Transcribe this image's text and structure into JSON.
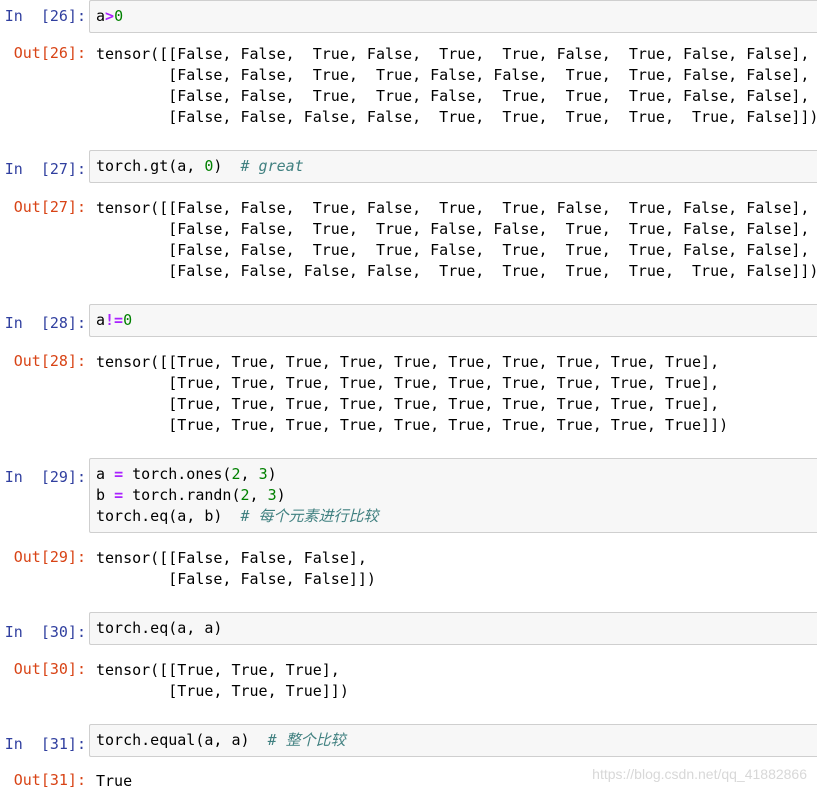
{
  "cells": [
    {
      "in_prompt": "In  [26]:",
      "code": [
        [
          {
            "t": "a"
          },
          {
            "t": ">",
            "c": "op"
          },
          {
            "t": "0",
            "c": "num"
          }
        ]
      ],
      "out_prompt": "Out[26]:",
      "output": [
        "tensor([[False, False,  True, False,  True,  True, False,  True, False, False],",
        "        [False, False,  True,  True, False, False,  True,  True, False, False],",
        "        [False, False,  True,  True, False,  True,  True,  True, False, False],",
        "        [False, False, False, False,  True,  True,  True,  True,  True, False]])"
      ]
    },
    {
      "in_prompt": "In  [27]:",
      "code": [
        [
          {
            "t": "torch.gt(a, "
          },
          {
            "t": "0",
            "c": "num"
          },
          {
            "t": ")  "
          },
          {
            "t": "# great",
            "c": "cmt"
          }
        ]
      ],
      "out_prompt": "Out[27]:",
      "output": [
        "tensor([[False, False,  True, False,  True,  True, False,  True, False, False],",
        "        [False, False,  True,  True, False, False,  True,  True, False, False],",
        "        [False, False,  True,  True, False,  True,  True,  True, False, False],",
        "        [False, False, False, False,  True,  True,  True,  True,  True, False]])"
      ]
    },
    {
      "in_prompt": "In  [28]:",
      "code": [
        [
          {
            "t": "a"
          },
          {
            "t": "!=",
            "c": "op"
          },
          {
            "t": "0",
            "c": "num"
          }
        ]
      ],
      "out_prompt": "Out[28]:",
      "output": [
        "tensor([[True, True, True, True, True, True, True, True, True, True],",
        "        [True, True, True, True, True, True, True, True, True, True],",
        "        [True, True, True, True, True, True, True, True, True, True],",
        "        [True, True, True, True, True, True, True, True, True, True]])"
      ]
    },
    {
      "in_prompt": "In  [29]:",
      "code": [
        [
          {
            "t": "a "
          },
          {
            "t": "=",
            "c": "op"
          },
          {
            "t": " torch.ones("
          },
          {
            "t": "2",
            "c": "num"
          },
          {
            "t": ", "
          },
          {
            "t": "3",
            "c": "num"
          },
          {
            "t": ")"
          }
        ],
        [
          {
            "t": "b "
          },
          {
            "t": "=",
            "c": "op"
          },
          {
            "t": " torch.randn("
          },
          {
            "t": "2",
            "c": "num"
          },
          {
            "t": ", "
          },
          {
            "t": "3",
            "c": "num"
          },
          {
            "t": ")"
          }
        ],
        [
          {
            "t": "torch.eq(a, b)  "
          },
          {
            "t": "# 每个元素进行比较",
            "c": "cmt"
          }
        ]
      ],
      "out_prompt": "Out[29]:",
      "output": [
        "tensor([[False, False, False],",
        "        [False, False, False]])"
      ]
    },
    {
      "in_prompt": "In  [30]:",
      "code": [
        [
          {
            "t": "torch.eq(a, a)"
          }
        ]
      ],
      "out_prompt": "Out[30]:",
      "output": [
        "tensor([[True, True, True],",
        "        [True, True, True]])"
      ]
    },
    {
      "in_prompt": "In  [31]:",
      "code": [
        [
          {
            "t": "torch.equal(a, a)  "
          },
          {
            "t": "# 整个比较",
            "c": "cmt"
          }
        ]
      ],
      "out_prompt": "Out[31]:",
      "output": [
        "True"
      ]
    }
  ],
  "watermark": "https://blog.csdn.net/qq_41882866"
}
